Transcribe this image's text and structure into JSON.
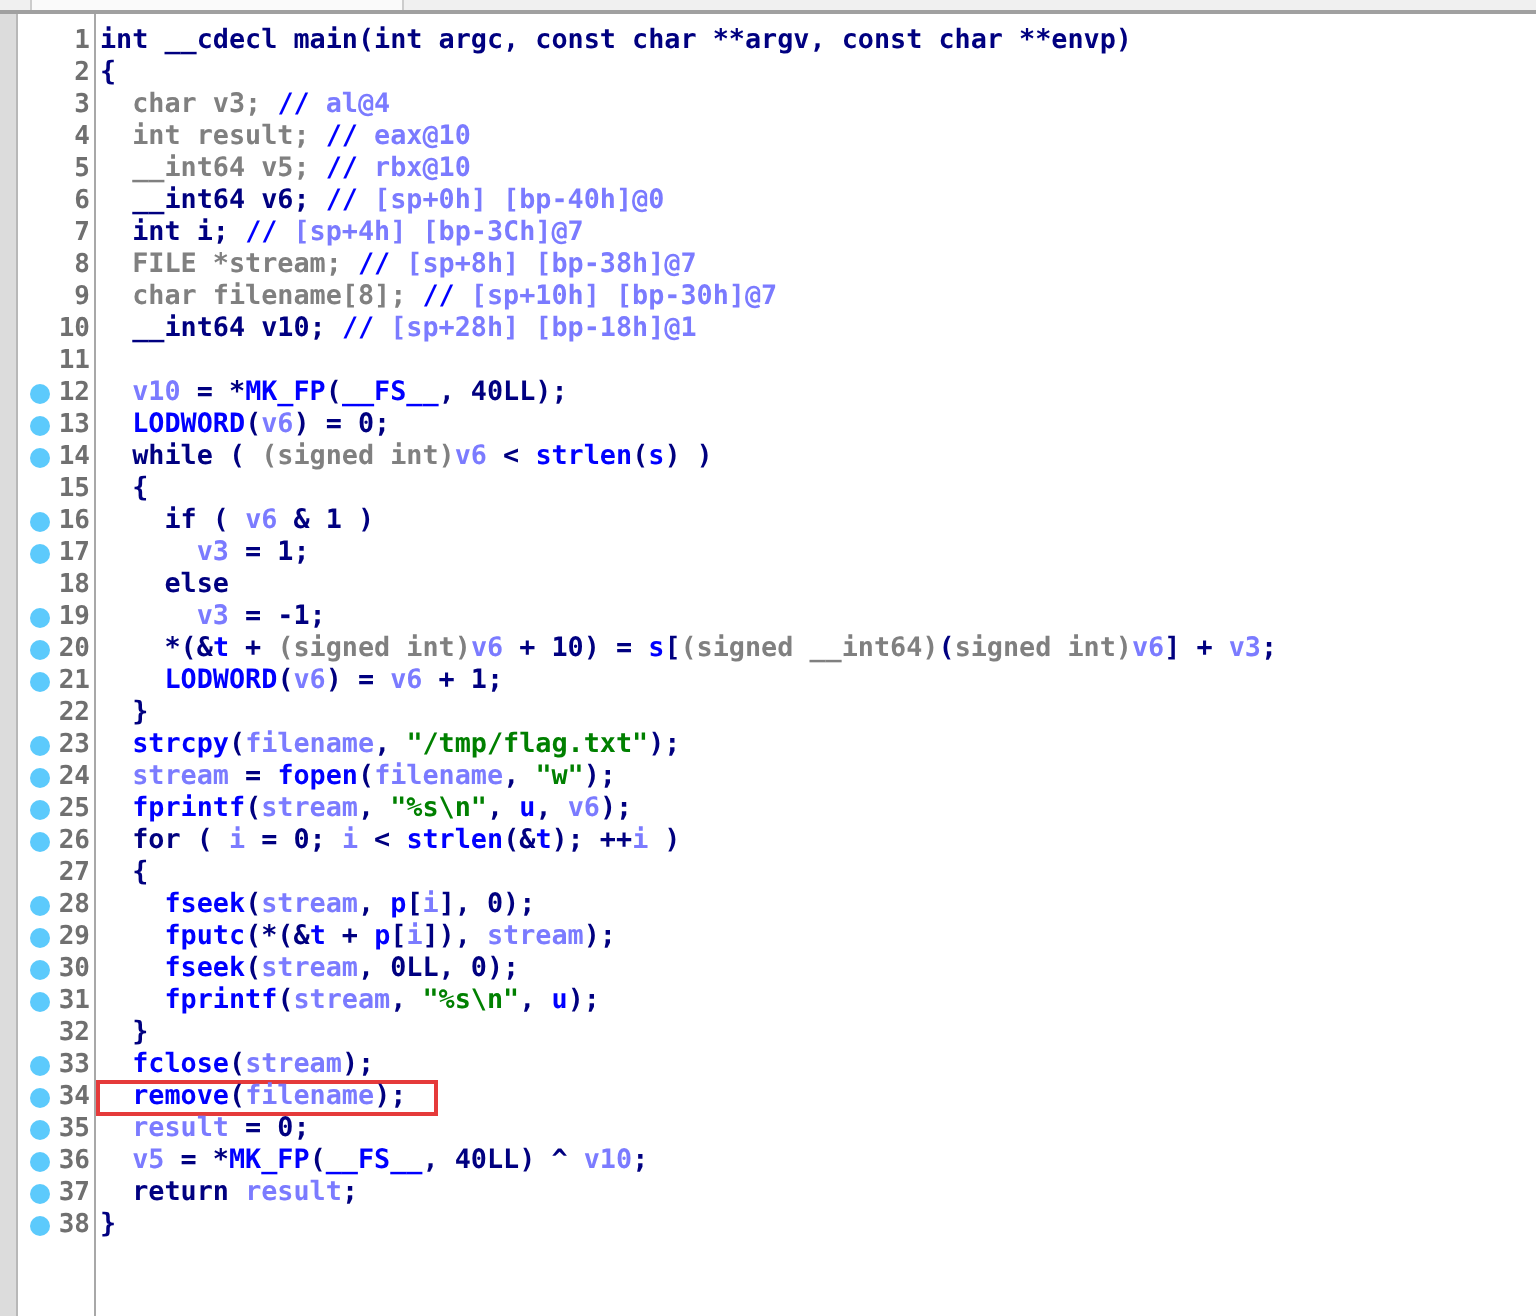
{
  "lines": [
    {
      "number": "1",
      "marked": false,
      "highlighted": false,
      "tokens": [
        {
          "kind": "plain",
          "text": "int __cdecl main(int argc, const char **argv, const char **envp)"
        }
      ]
    },
    {
      "number": "2",
      "marked": false,
      "highlighted": false,
      "tokens": [
        {
          "kind": "plain",
          "text": "{"
        }
      ]
    },
    {
      "number": "3",
      "marked": false,
      "highlighted": false,
      "tokens": [
        {
          "kind": "unused",
          "text": "  char v3; "
        },
        {
          "kind": "call",
          "text": "//"
        },
        {
          "kind": "var",
          "text": " al@4"
        }
      ]
    },
    {
      "number": "4",
      "marked": false,
      "highlighted": false,
      "tokens": [
        {
          "kind": "unused",
          "text": "  int result; "
        },
        {
          "kind": "call",
          "text": "//"
        },
        {
          "kind": "var",
          "text": " eax@10"
        }
      ]
    },
    {
      "number": "5",
      "marked": false,
      "highlighted": false,
      "tokens": [
        {
          "kind": "unused",
          "text": "  __int64 v5; "
        },
        {
          "kind": "call",
          "text": "//"
        },
        {
          "kind": "var",
          "text": " rbx@10"
        }
      ]
    },
    {
      "number": "6",
      "marked": false,
      "highlighted": false,
      "tokens": [
        {
          "kind": "plain",
          "text": "  __int64 v6; "
        },
        {
          "kind": "call",
          "text": "//"
        },
        {
          "kind": "var",
          "text": " [sp+0h] [bp-40h]@0"
        }
      ]
    },
    {
      "number": "7",
      "marked": false,
      "highlighted": false,
      "tokens": [
        {
          "kind": "plain",
          "text": "  int i; "
        },
        {
          "kind": "call",
          "text": "//"
        },
        {
          "kind": "var",
          "text": " [sp+4h] [bp-3Ch]@7"
        }
      ]
    },
    {
      "number": "8",
      "marked": false,
      "highlighted": false,
      "tokens": [
        {
          "kind": "unused",
          "text": "  FILE *stream; "
        },
        {
          "kind": "call",
          "text": "//"
        },
        {
          "kind": "var",
          "text": " [sp+8h] [bp-38h]@7"
        }
      ]
    },
    {
      "number": "9",
      "marked": false,
      "highlighted": false,
      "tokens": [
        {
          "kind": "unused",
          "text": "  char filename[8]; "
        },
        {
          "kind": "call",
          "text": "//"
        },
        {
          "kind": "var",
          "text": " [sp+10h] [bp-30h]@7"
        }
      ]
    },
    {
      "number": "10",
      "marked": false,
      "highlighted": false,
      "tokens": [
        {
          "kind": "plain",
          "text": "  __int64 v10; "
        },
        {
          "kind": "call",
          "text": "//"
        },
        {
          "kind": "var",
          "text": " [sp+28h] [bp-18h]@1"
        }
      ]
    },
    {
      "number": "11",
      "marked": false,
      "highlighted": false
    },
    {
      "number": "12",
      "marked": true,
      "highlighted": false,
      "tokens": [
        {
          "kind": "var",
          "text": "  v10"
        },
        {
          "kind": "plain",
          "text": " = *"
        },
        {
          "kind": "call",
          "text": "MK_FP"
        },
        {
          "kind": "plain",
          "text": "("
        },
        {
          "kind": "call",
          "text": "__FS__"
        },
        {
          "kind": "plain",
          "text": ", 40LL);"
        }
      ]
    },
    {
      "number": "13",
      "marked": true,
      "highlighted": false,
      "tokens": [
        {
          "kind": "call",
          "text": "  LODWORD"
        },
        {
          "kind": "plain",
          "text": "("
        },
        {
          "kind": "var",
          "text": "v6"
        },
        {
          "kind": "plain",
          "text": ") = 0;"
        }
      ]
    },
    {
      "number": "14",
      "marked": true,
      "highlighted": false,
      "tokens": [
        {
          "kind": "plain",
          "text": "  while ( "
        },
        {
          "kind": "unused",
          "text": "(signed int)"
        },
        {
          "kind": "var",
          "text": "v6"
        },
        {
          "kind": "plain",
          "text": " < "
        },
        {
          "kind": "call",
          "text": "strlen"
        },
        {
          "kind": "plain",
          "text": "("
        },
        {
          "kind": "call",
          "text": "s"
        },
        {
          "kind": "plain",
          "text": ") )"
        }
      ]
    },
    {
      "number": "15",
      "marked": false,
      "highlighted": false,
      "tokens": [
        {
          "kind": "plain",
          "text": "  {"
        }
      ]
    },
    {
      "number": "16",
      "marked": true,
      "highlighted": false,
      "tokens": [
        {
          "kind": "plain",
          "text": "    if ( "
        },
        {
          "kind": "var",
          "text": "v6"
        },
        {
          "kind": "plain",
          "text": " & 1 )"
        }
      ]
    },
    {
      "number": "17",
      "marked": true,
      "highlighted": false,
      "tokens": [
        {
          "kind": "var",
          "text": "      v3"
        },
        {
          "kind": "plain",
          "text": " = 1;"
        }
      ]
    },
    {
      "number": "18",
      "marked": false,
      "highlighted": false,
      "tokens": [
        {
          "kind": "plain",
          "text": "    else"
        }
      ]
    },
    {
      "number": "19",
      "marked": true,
      "highlighted": false,
      "tokens": [
        {
          "kind": "var",
          "text": "      v3"
        },
        {
          "kind": "plain",
          "text": " = -1;"
        }
      ]
    },
    {
      "number": "20",
      "marked": true,
      "highlighted": false,
      "tokens": [
        {
          "kind": "plain",
          "text": "    *(&"
        },
        {
          "kind": "call",
          "text": "t"
        },
        {
          "kind": "plain",
          "text": " + "
        },
        {
          "kind": "unused",
          "text": "(signed int)"
        },
        {
          "kind": "var",
          "text": "v6"
        },
        {
          "kind": "plain",
          "text": " + 10) = "
        },
        {
          "kind": "call",
          "text": "s"
        },
        {
          "kind": "plain",
          "text": "["
        },
        {
          "kind": "unused",
          "text": "(signed __int64)"
        },
        {
          "kind": "plain",
          "text": "("
        },
        {
          "kind": "unused",
          "text": "signed int)"
        },
        {
          "kind": "var",
          "text": "v6"
        },
        {
          "kind": "plain",
          "text": "] + "
        },
        {
          "kind": "var",
          "text": "v3"
        },
        {
          "kind": "plain",
          "text": ";"
        }
      ]
    },
    {
      "number": "21",
      "marked": true,
      "highlighted": false,
      "tokens": [
        {
          "kind": "call",
          "text": "    LODWORD"
        },
        {
          "kind": "plain",
          "text": "("
        },
        {
          "kind": "var",
          "text": "v6"
        },
        {
          "kind": "plain",
          "text": ") = "
        },
        {
          "kind": "var",
          "text": "v6"
        },
        {
          "kind": "plain",
          "text": " + 1;"
        }
      ]
    },
    {
      "number": "22",
      "marked": false,
      "highlighted": false,
      "tokens": [
        {
          "kind": "plain",
          "text": "  }"
        }
      ]
    },
    {
      "number": "23",
      "marked": true,
      "highlighted": false,
      "tokens": [
        {
          "kind": "call",
          "text": "  strcpy"
        },
        {
          "kind": "plain",
          "text": "("
        },
        {
          "kind": "var",
          "text": "filename"
        },
        {
          "kind": "plain",
          "text": ", "
        },
        {
          "kind": "string",
          "text": "\"/tmp/flag.txt\""
        },
        {
          "kind": "plain",
          "text": ");"
        }
      ]
    },
    {
      "number": "24",
      "marked": true,
      "highlighted": false,
      "tokens": [
        {
          "kind": "var",
          "text": "  stream"
        },
        {
          "kind": "plain",
          "text": " = "
        },
        {
          "kind": "call",
          "text": "fopen"
        },
        {
          "kind": "plain",
          "text": "("
        },
        {
          "kind": "var",
          "text": "filename"
        },
        {
          "kind": "plain",
          "text": ", "
        },
        {
          "kind": "string",
          "text": "\"w\""
        },
        {
          "kind": "plain",
          "text": ");"
        }
      ]
    },
    {
      "number": "25",
      "marked": true,
      "highlighted": false,
      "tokens": [
        {
          "kind": "call",
          "text": "  fprintf"
        },
        {
          "kind": "plain",
          "text": "("
        },
        {
          "kind": "var",
          "text": "stream"
        },
        {
          "kind": "plain",
          "text": ", "
        },
        {
          "kind": "string",
          "text": "\"%s\\n\""
        },
        {
          "kind": "plain",
          "text": ", "
        },
        {
          "kind": "call",
          "text": "u"
        },
        {
          "kind": "plain",
          "text": ", "
        },
        {
          "kind": "var",
          "text": "v6"
        },
        {
          "kind": "plain",
          "text": ");"
        }
      ]
    },
    {
      "number": "26",
      "marked": true,
      "highlighted": false,
      "tokens": [
        {
          "kind": "plain",
          "text": "  for ( "
        },
        {
          "kind": "var",
          "text": "i"
        },
        {
          "kind": "plain",
          "text": " = 0; "
        },
        {
          "kind": "var",
          "text": "i"
        },
        {
          "kind": "plain",
          "text": " < "
        },
        {
          "kind": "call",
          "text": "strlen"
        },
        {
          "kind": "plain",
          "text": "(&"
        },
        {
          "kind": "call",
          "text": "t"
        },
        {
          "kind": "plain",
          "text": "); ++"
        },
        {
          "kind": "var",
          "text": "i"
        },
        {
          "kind": "plain",
          "text": " )"
        }
      ]
    },
    {
      "number": "27",
      "marked": false,
      "highlighted": false,
      "tokens": [
        {
          "kind": "plain",
          "text": "  {"
        }
      ]
    },
    {
      "number": "28",
      "marked": true,
      "highlighted": false,
      "tokens": [
        {
          "kind": "call",
          "text": "    fseek"
        },
        {
          "kind": "plain",
          "text": "("
        },
        {
          "kind": "var",
          "text": "stream"
        },
        {
          "kind": "plain",
          "text": ", "
        },
        {
          "kind": "call",
          "text": "p"
        },
        {
          "kind": "plain",
          "text": "["
        },
        {
          "kind": "var",
          "text": "i"
        },
        {
          "kind": "plain",
          "text": "], 0);"
        }
      ]
    },
    {
      "number": "29",
      "marked": true,
      "highlighted": false,
      "tokens": [
        {
          "kind": "call",
          "text": "    fputc"
        },
        {
          "kind": "plain",
          "text": "(*(&"
        },
        {
          "kind": "call",
          "text": "t"
        },
        {
          "kind": "plain",
          "text": " + "
        },
        {
          "kind": "call",
          "text": "p"
        },
        {
          "kind": "plain",
          "text": "["
        },
        {
          "kind": "var",
          "text": "i"
        },
        {
          "kind": "plain",
          "text": "]), "
        },
        {
          "kind": "var",
          "text": "stream"
        },
        {
          "kind": "plain",
          "text": ");"
        }
      ]
    },
    {
      "number": "30",
      "marked": true,
      "highlighted": false,
      "tokens": [
        {
          "kind": "call",
          "text": "    fseek"
        },
        {
          "kind": "plain",
          "text": "("
        },
        {
          "kind": "var",
          "text": "stream"
        },
        {
          "kind": "plain",
          "text": ", 0LL, 0);"
        }
      ]
    },
    {
      "number": "31",
      "marked": true,
      "highlighted": false,
      "tokens": [
        {
          "kind": "call",
          "text": "    fprintf"
        },
        {
          "kind": "plain",
          "text": "("
        },
        {
          "kind": "var",
          "text": "stream"
        },
        {
          "kind": "plain",
          "text": ", "
        },
        {
          "kind": "string",
          "text": "\"%s\\n\""
        },
        {
          "kind": "plain",
          "text": ", "
        },
        {
          "kind": "call",
          "text": "u"
        },
        {
          "kind": "plain",
          "text": ");"
        }
      ]
    },
    {
      "number": "32",
      "marked": false,
      "highlighted": false,
      "tokens": [
        {
          "kind": "plain",
          "text": "  }"
        }
      ]
    },
    {
      "number": "33",
      "marked": true,
      "highlighted": false,
      "tokens": [
        {
          "kind": "call",
          "text": "  fclose"
        },
        {
          "kind": "plain",
          "text": "("
        },
        {
          "kind": "var",
          "text": "stream"
        },
        {
          "kind": "plain",
          "text": ");"
        }
      ]
    },
    {
      "number": "34",
      "marked": true,
      "highlighted": true,
      "tokens": [
        {
          "kind": "call",
          "text": "  remove"
        },
        {
          "kind": "plain",
          "text": "("
        },
        {
          "kind": "var",
          "text": "filename"
        },
        {
          "kind": "plain",
          "text": ");"
        }
      ]
    },
    {
      "number": "35",
      "marked": true,
      "highlighted": false,
      "tokens": [
        {
          "kind": "var",
          "text": "  result"
        },
        {
          "kind": "plain",
          "text": " = 0;"
        }
      ]
    },
    {
      "number": "36",
      "marked": true,
      "highlighted": false,
      "tokens": [
        {
          "kind": "var",
          "text": "  v5"
        },
        {
          "kind": "plain",
          "text": " = *"
        },
        {
          "kind": "call",
          "text": "MK_FP"
        },
        {
          "kind": "plain",
          "text": "("
        },
        {
          "kind": "call",
          "text": "__FS__"
        },
        {
          "kind": "plain",
          "text": ", 40LL) ^ "
        },
        {
          "kind": "var",
          "text": "v10"
        },
        {
          "kind": "plain",
          "text": ";"
        }
      ]
    },
    {
      "number": "37",
      "marked": true,
      "highlighted": false,
      "tokens": [
        {
          "kind": "plain",
          "text": "  return "
        },
        {
          "kind": "var",
          "text": "result"
        },
        {
          "kind": "plain",
          "text": ";"
        }
      ]
    },
    {
      "number": "38",
      "marked": true,
      "highlighted": false,
      "tokens": [
        {
          "kind": "plain",
          "text": "}"
        }
      ]
    }
  ]
}
